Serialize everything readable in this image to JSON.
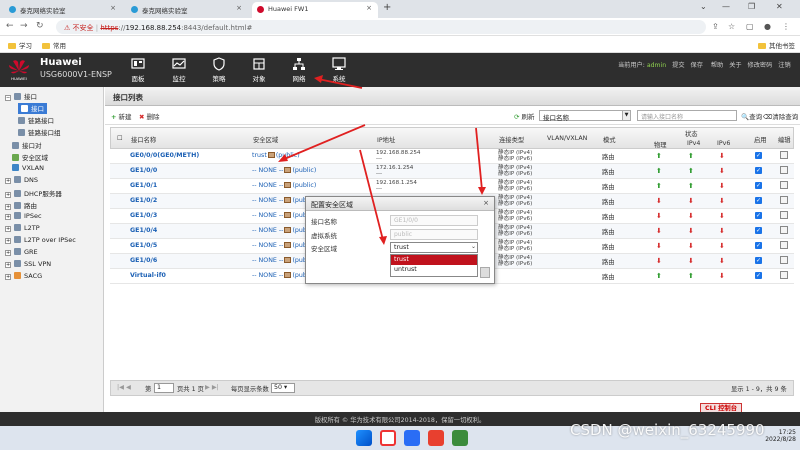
{
  "browser": {
    "tabs": [
      {
        "label": "泰克网络实验室",
        "icon_color": "#2a9bd6"
      },
      {
        "label": "泰克网络实验室",
        "icon_color": "#2a9bd6"
      },
      {
        "label": "Huawei FW1",
        "icon_color": "#cf0a2c"
      }
    ],
    "new_tab": "+",
    "url": {
      "warning": "不安全",
      "scheme": "https",
      "host": "192.168.88.254",
      "path": ":8443/default.html#"
    },
    "bookmarks": [
      "学习",
      "常用"
    ],
    "other_bookmarks": "其他书签"
  },
  "app": {
    "brand_line1": "Huawei",
    "brand_line2": "USG6000V1-ENSP",
    "logo_text": "HUAWEI",
    "nav": [
      {
        "label": "面板",
        "icon": "panel-icon"
      },
      {
        "label": "监控",
        "icon": "monitor-icon"
      },
      {
        "label": "策略",
        "icon": "policy-icon"
      },
      {
        "label": "对象",
        "icon": "object-icon"
      },
      {
        "label": "网络",
        "icon": "network-icon"
      },
      {
        "label": "系统",
        "icon": "system-icon"
      }
    ],
    "user": {
      "current_user_label": "当前用户:",
      "user": "admin",
      "links": [
        "提交",
        "保存",
        "帮助",
        "关于",
        "修改密码",
        "注销"
      ]
    }
  },
  "sidebar": {
    "items": [
      {
        "label": "接口",
        "expander": "−",
        "icon_color": "#7a8fa8"
      },
      {
        "label": "接口",
        "icon_color": "#3a7bd5",
        "selected": true
      },
      {
        "label": "链路接口",
        "icon_color": "#7a8fa8"
      },
      {
        "label": "链路接口组",
        "icon_color": "#7a8fa8"
      },
      {
        "label": "接口对",
        "icon_color": "#7a8fa8"
      },
      {
        "label": "安全区域",
        "icon_color": "#6aa84f"
      },
      {
        "label": "VXLAN",
        "icon_color": "#3d85c6"
      },
      {
        "label": "DNS",
        "expander": "+",
        "icon_color": "#7a8fa8"
      },
      {
        "label": "DHCP服务器",
        "expander": "+",
        "icon_color": "#7a8fa8"
      },
      {
        "label": "路由",
        "expander": "+",
        "icon_color": "#7a8fa8"
      },
      {
        "label": "IPSec",
        "expander": "+",
        "icon_color": "#7a8fa8"
      },
      {
        "label": "L2TP",
        "expander": "+",
        "icon_color": "#7a8fa8"
      },
      {
        "label": "L2TP over IPSec",
        "expander": "+",
        "icon_color": "#7a8fa8"
      },
      {
        "label": "GRE",
        "expander": "+",
        "icon_color": "#7a8fa8"
      },
      {
        "label": "SSL VPN",
        "expander": "+",
        "icon_color": "#7a8fa8"
      },
      {
        "label": "SACG",
        "expander": "+",
        "icon_color": "#e69138"
      }
    ]
  },
  "main": {
    "title": "接口列表",
    "toolbar": {
      "new": "新建",
      "delete": "删除",
      "refresh": "刷新",
      "filter_field": "接口名称",
      "search_placeholder": "请输入接口名称",
      "query": "查询",
      "clear": "清除查询"
    },
    "columns": {
      "name": "接口名称",
      "zone": "安全区域",
      "ip": "IP地址",
      "conn": "连接类型",
      "vlan": "VLAN/VXLAN",
      "mode": "模式",
      "status": "状态",
      "physical": "物理",
      "ipv4": "IPv4",
      "ipv6": "IPv6",
      "enable": "启用",
      "edit": "编辑"
    },
    "rows": [
      {
        "name": "GE0/0/0(GE0/METH)",
        "zone": "trust",
        "zone_suffix": "(public)",
        "ip1": "192.168.88.254",
        "ip2": "---",
        "conn1": "静态IP (IPv4)",
        "conn2": "静态IP (IPv6)",
        "mode": "路由",
        "phys": "up",
        "v4": "up",
        "v6": "down"
      },
      {
        "name": "GE1/0/0",
        "zone": "-- NONE --",
        "zone_suffix": "(public)",
        "ip1": "172.16.1.254",
        "ip2": "---",
        "conn1": "静态IP (IPv4)",
        "conn2": "静态IP (IPv6)",
        "mode": "路由",
        "phys": "up",
        "v4": "up",
        "v6": "down"
      },
      {
        "name": "GE1/0/1",
        "zone": "-- NONE --",
        "zone_suffix": "(public)",
        "ip1": "192.168.1.254",
        "ip2": "---",
        "conn1": "静态IP (IPv4)",
        "conn2": "静态IP (IPv6)",
        "mode": "路由",
        "phys": "up",
        "v4": "up",
        "v6": "down"
      },
      {
        "name": "GE1/0/2",
        "zone": "-- NONE --",
        "zone_suffix": "(public)",
        "ip1": "",
        "ip2": "",
        "conn1": "静态IP (IPv4)",
        "conn2": "静态IP (IPv6)",
        "mode": "路由",
        "phys": "down",
        "v4": "down",
        "v6": "down"
      },
      {
        "name": "GE1/0/3",
        "zone": "-- NONE --",
        "zone_suffix": "(public)",
        "ip1": "",
        "ip2": "",
        "conn1": "静态IP (IPv4)",
        "conn2": "静态IP (IPv6)",
        "mode": "路由",
        "phys": "down",
        "v4": "down",
        "v6": "down"
      },
      {
        "name": "GE1/0/4",
        "zone": "-- NONE --",
        "zone_suffix": "(public)",
        "ip1": "",
        "ip2": "",
        "conn1": "静态IP (IPv4)",
        "conn2": "静态IP (IPv6)",
        "mode": "路由",
        "phys": "down",
        "v4": "down",
        "v6": "down"
      },
      {
        "name": "GE1/0/5",
        "zone": "-- NONE --",
        "zone_suffix": "(public)",
        "ip1": "",
        "ip2": "",
        "conn1": "静态IP (IPv4)",
        "conn2": "静态IP (IPv6)",
        "mode": "路由",
        "phys": "down",
        "v4": "down",
        "v6": "down"
      },
      {
        "name": "GE1/0/6",
        "zone": "-- NONE --",
        "zone_suffix": "(public)",
        "ip1": "",
        "ip2": "",
        "conn1": "静态IP (IPv4)",
        "conn2": "静态IP (IPv6)",
        "mode": "路由",
        "phys": "down",
        "v4": "down",
        "v6": "down"
      },
      {
        "name": "Virtual-if0",
        "zone": "-- NONE --",
        "zone_suffix": "(public)",
        "ip1": "",
        "ip2": "",
        "conn1": "",
        "conn2": "",
        "mode": "路由",
        "phys": "up",
        "v4": "up",
        "v6": "down"
      }
    ],
    "pager": {
      "page_prefix": "第",
      "page_value": "1",
      "page_total": "页共 1 页",
      "per_page_label": "每页显示条数",
      "per_page_value": "50",
      "summary": "显示 1 - 9，共 9 条"
    }
  },
  "dialog": {
    "title": "配置安全区域",
    "close": "×",
    "labels": {
      "name": "接口名称",
      "vsys": "虚拟系统",
      "zone": "安全区域"
    },
    "values": {
      "name": "GE1/0/0",
      "vsys": "public"
    },
    "zone_select_value": "trust",
    "options": [
      "trust",
      "untrust"
    ],
    "highlighted": "trust"
  },
  "footer": {
    "copyright": "版权所有 © 华为技术有限公司2014-2018，保留一切权利。",
    "cli_button": "CLI 控制台"
  },
  "taskbar": {
    "time": "17:25",
    "date": "2022/8/28"
  },
  "watermark": "CSDN @weixin_63245990"
}
